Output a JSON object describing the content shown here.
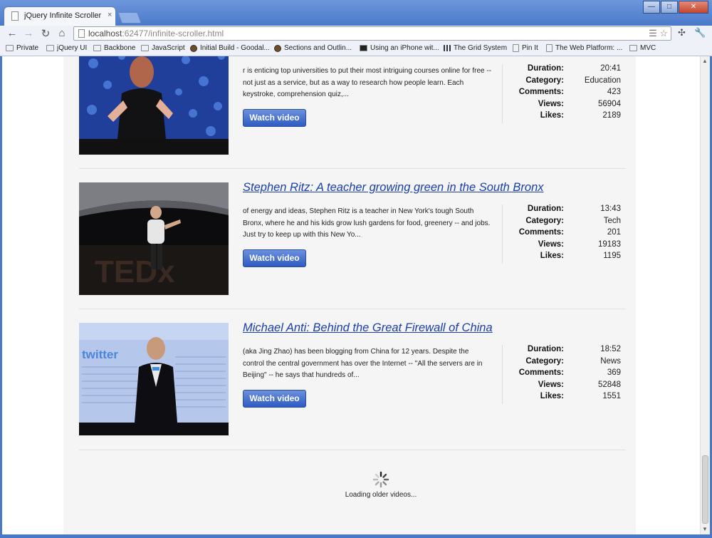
{
  "browser": {
    "tab_title": "jQuery Infinite Scroller",
    "tab_close": "×",
    "url_host": "localhost",
    "url_port": ":62477",
    "url_path": "/infinite-scroller.html",
    "window_buttons": [
      "—",
      "□",
      "✕"
    ],
    "nav": {
      "back": "←",
      "forward": "→",
      "reload": "↻",
      "home": "⌂"
    },
    "omni_icons": "☰ ☆",
    "tools": {
      "ext": "✣",
      "wrench": "🔧"
    }
  },
  "bookmarks": [
    {
      "label": "Private",
      "icon": "folder-icon"
    },
    {
      "label": "jQuery UI",
      "icon": "folder-icon"
    },
    {
      "label": "Backbone",
      "icon": "folder-icon"
    },
    {
      "label": "JavaScript",
      "icon": "folder-icon"
    },
    {
      "label": "Initial Build - Goodal...",
      "icon": "globe-icon"
    },
    {
      "label": "Sections and Outlin...",
      "icon": "puzzle-icon"
    },
    {
      "label": "Using an iPhone wit...",
      "icon": "phone-icon"
    },
    {
      "label": "The Grid System",
      "icon": "grid-icon"
    },
    {
      "label": "Pin It",
      "icon": "page-icon"
    },
    {
      "label": "The Web Platform: ...",
      "icon": "page-icon"
    },
    {
      "label": "MVC",
      "icon": "folder-icon"
    }
  ],
  "stat_labels": {
    "duration": "Duration:",
    "category": "Category:",
    "comments": "Comments:",
    "views": "Views:",
    "likes": "Likes:"
  },
  "videos": [
    {
      "title": "",
      "description": "r is enticing top universities to put their most intriguing courses online for free -- not just as a service, but as a way to research how people learn. Each keystroke, comprehension quiz,...",
      "button": "Watch video",
      "duration": "20:41",
      "category": "Education",
      "comments": "423",
      "views": "56904",
      "likes": "2189"
    },
    {
      "title": "Stephen Ritz: A teacher growing green in the South Bronx",
      "description": "of energy and ideas, Stephen Ritz is a teacher in New York's tough South Bronx, where he and his kids grow lush gardens for food, greenery -- and jobs. Just try to keep up with this New Yo...",
      "button": "Watch video",
      "duration": "13:43",
      "category": "Tech",
      "comments": "201",
      "views": "19183",
      "likes": "1195"
    },
    {
      "title": "Michael Anti: Behind the Great Firewall of China",
      "description": "(aka Jing Zhao) has been blogging from China for 12 years. Despite the control the central government has over the Internet -- \"All the servers are in Beijing\" -- he says that hundreds of...",
      "button": "Watch video",
      "duration": "18:52",
      "category": "News",
      "comments": "369",
      "views": "52848",
      "likes": "1551"
    }
  ],
  "loading_text": "Loading older videos...",
  "thumb_text": {
    "twitter": "twitter",
    "tedx": "TEDx"
  }
}
